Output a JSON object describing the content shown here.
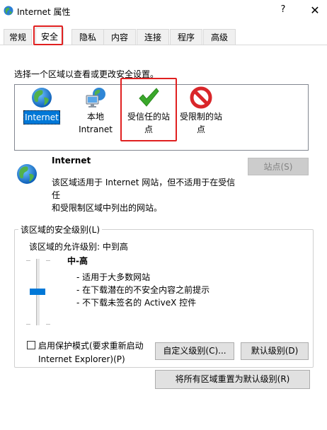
{
  "window": {
    "title": "Internet 属性",
    "help": "?",
    "close": "✕"
  },
  "tabs": [
    {
      "label": "常规"
    },
    {
      "label": "安全",
      "active": true
    },
    {
      "label": "隐私"
    },
    {
      "label": "内容"
    },
    {
      "label": "连接"
    },
    {
      "label": "程序"
    },
    {
      "label": "高级"
    }
  ],
  "security": {
    "zone_prompt": "选择一个区域以查看或更改安全设置。",
    "zones": [
      {
        "line1": "Internet",
        "line2": "",
        "icon": "globe-icon",
        "selected": true
      },
      {
        "line1": "本地",
        "line2": "Intranet",
        "icon": "intranet-icon"
      },
      {
        "line1": "受信任的站",
        "line2": "点",
        "icon": "checkmark-icon"
      },
      {
        "line1": "受限制的站",
        "line2": "点",
        "icon": "restricted-icon"
      }
    ],
    "info": {
      "title": "Internet",
      "desc_line1": "该区域适用于 Internet 网站，但不适用于在受信任",
      "desc_line2": "和受限制区域中列出的网站。",
      "sites_button": "站点(S)"
    },
    "level_group": {
      "label": "该区域的安全级别(L)",
      "allowed": "该区域的允许级别: 中到高",
      "level_name": "中-高",
      "level_items": [
        "- 适用于大多数网站",
        "- 在下载潜在的不安全内容之前提示",
        "- 不下载未签名的 ActiveX 控件"
      ],
      "slider_level": "中-高",
      "protected_mode_line1": "启用保护模式(要求重新启动",
      "protected_mode_line2": "Internet Explorer)(P)",
      "protected_mode_checked": false,
      "custom_button": "自定义级别(C)...",
      "default_button": "默认级别(D)"
    },
    "reset_all_button": "将所有区域重置为默认级别(R)"
  },
  "colors": {
    "accent": "#0078d7",
    "highlight_box": "#e02020",
    "check_green": "#3aa82b",
    "restricted_red": "#d9262a"
  }
}
